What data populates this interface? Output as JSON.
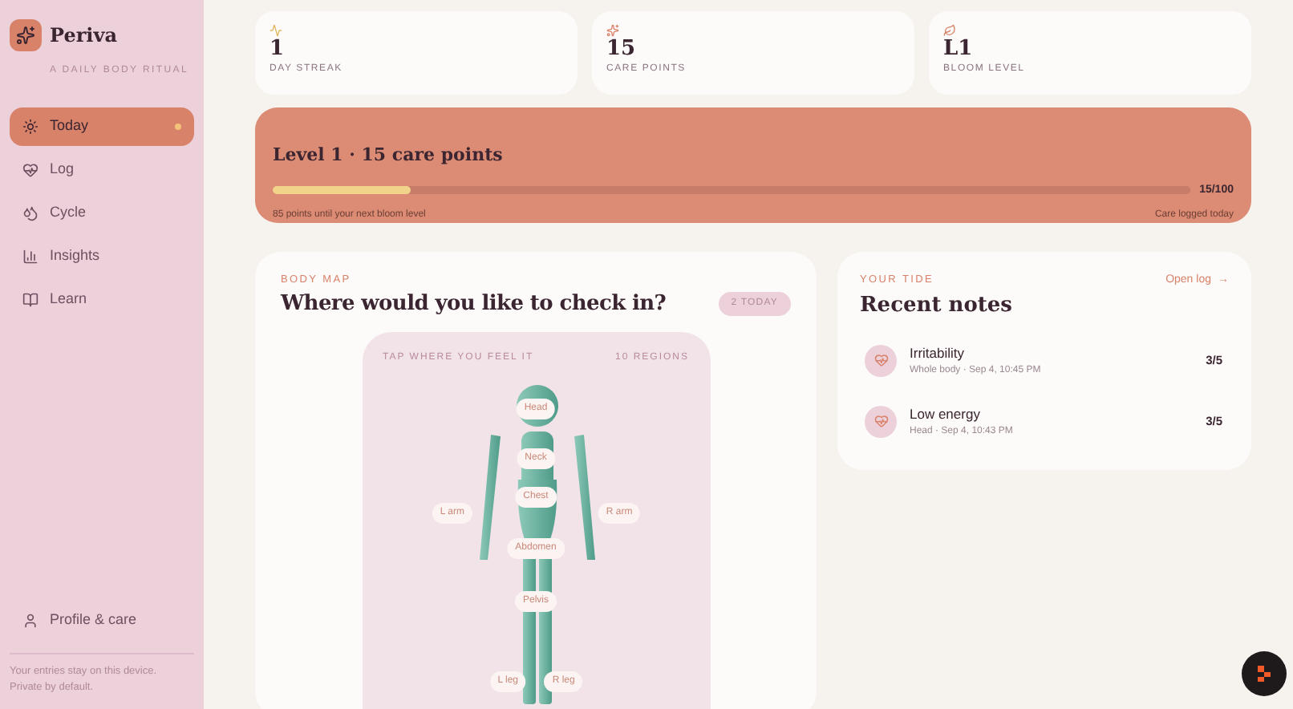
{
  "sidebar": {
    "brand": "Periva",
    "tagline": "A DAILY BODY RITUAL",
    "items": [
      {
        "label": "Today",
        "selected": true,
        "dot": true
      },
      {
        "label": "Log",
        "selected": false,
        "dot": false
      },
      {
        "label": "Cycle",
        "selected": false,
        "dot": false
      },
      {
        "label": "Insights",
        "selected": false,
        "dot": false
      },
      {
        "label": "Learn",
        "selected": false,
        "dot": false
      }
    ],
    "profile": "Profile & care",
    "footer": "Your entries stay on this device. Private by default."
  },
  "stats": [
    {
      "value": "1",
      "label": "DAY STREAK"
    },
    {
      "value": "15",
      "label": "CARE POINTS"
    },
    {
      "value": "L1",
      "label": "BLOOM LEVEL"
    }
  ],
  "progress": {
    "title": "Level 1 · 15 care points",
    "level": 0.15,
    "reading": "15/100",
    "hint": "85 points until your next bloom level",
    "status": "Care logged today"
  },
  "body_map": {
    "eyebrow": "BODY MAP",
    "title": "Where would you like to check in?",
    "badge": "2 TODAY",
    "caption": "TAP WHERE YOU FEEL IT",
    "count": "10 REGIONS",
    "regions": [
      "Head",
      "Neck",
      "Chest",
      "L arm",
      "R arm",
      "Abdomen",
      "Pelvis",
      "L leg",
      "R leg"
    ]
  },
  "notes": {
    "eyebrow": "YOUR TIDE",
    "title": "Recent notes",
    "link": "Open log",
    "link_arrow": "→",
    "items": [
      {
        "name": "Irritability",
        "meta": "Whole body · Sep 4, 10:45 PM",
        "score": "3/5"
      },
      {
        "name": "Low energy",
        "meta": "Head · Sep 4, 10:43 PM",
        "score": "3/5"
      }
    ]
  }
}
